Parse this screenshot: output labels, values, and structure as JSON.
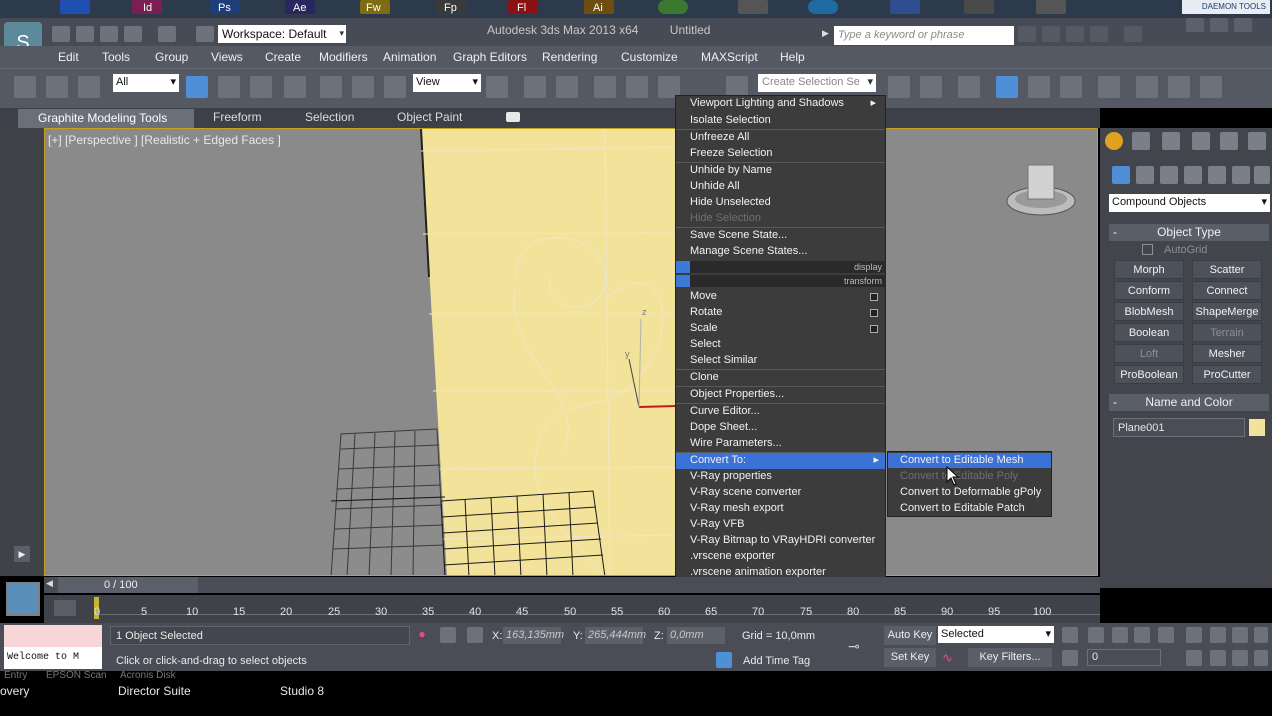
{
  "app": {
    "title": "Autodesk 3ds Max  2013 x64",
    "document": "Untitled",
    "workspace": "Workspace: Default",
    "search_placeholder": "Type a keyword or phrase"
  },
  "taskbar": {
    "badge": "DAEMON TOOLS",
    "labels": [
      "Id",
      "Ps",
      "Ae",
      "Fw",
      "Fp",
      "Fl",
      "Ai"
    ]
  },
  "menubar": [
    "Edit",
    "Tools",
    "Group",
    "Views",
    "Create",
    "Modifiers",
    "Animation",
    "Graph Editors",
    "Rendering",
    "Customize",
    "MAXScript",
    "Help"
  ],
  "toolbar": {
    "selection_filter": "All",
    "ref_coord": "View",
    "named_selection": "Create Selection Se"
  },
  "ribbon": {
    "tabs": [
      "Graphite Modeling Tools",
      "Freeform",
      "Selection",
      "Object Paint"
    ]
  },
  "viewport": {
    "label": "[+] [Perspective ] [Realistic + Edged Faces ]",
    "axis_z": "z",
    "axis_y": "y"
  },
  "quad_menu": {
    "items": [
      {
        "label": "Viewport Lighting and Shadows",
        "submenu": true
      },
      {
        "label": "Isolate Selection"
      },
      {
        "label": "Unfreeze All"
      },
      {
        "label": "Freeze Selection"
      },
      {
        "label": "Unhide by Name"
      },
      {
        "label": "Unhide All"
      },
      {
        "label": "Hide Unselected"
      },
      {
        "label": "Hide Selection",
        "disabled": true
      },
      {
        "label": "Save Scene State..."
      },
      {
        "label": "Manage Scene States..."
      },
      {
        "label": "Move",
        "box": true
      },
      {
        "label": "Rotate",
        "box": true
      },
      {
        "label": "Scale",
        "box": true
      },
      {
        "label": "Select"
      },
      {
        "label": "Select Similar"
      },
      {
        "label": "Clone"
      },
      {
        "label": "Object Properties..."
      },
      {
        "label": "Curve Editor..."
      },
      {
        "label": "Dope Sheet..."
      },
      {
        "label": "Wire Parameters..."
      },
      {
        "label": "Convert To:",
        "submenu": true,
        "highlighted": true
      },
      {
        "label": "V-Ray properties"
      },
      {
        "label": "V-Ray scene converter"
      },
      {
        "label": "V-Ray mesh export"
      },
      {
        "label": "V-Ray VFB"
      },
      {
        "label": "V-Ray Bitmap to VRayHDRI converter"
      },
      {
        "label": ".vrscene exporter"
      },
      {
        "label": ".vrscene animation exporter"
      }
    ],
    "quad_labels": [
      "display",
      "transform"
    ]
  },
  "convert_submenu": [
    {
      "label": "Convert to Editable Mesh",
      "highlighted": true
    },
    {
      "label": "Convert to Editable Poly",
      "disabled": true
    },
    {
      "label": "Convert to Deformable gPoly"
    },
    {
      "label": "Convert to Editable Patch"
    }
  ],
  "command_panel": {
    "category": "Compound Objects",
    "object_type_title": "Object Type",
    "autogrid": "AutoGrid",
    "buttons": [
      {
        "label": "Morph"
      },
      {
        "label": "Scatter"
      },
      {
        "label": "Conform"
      },
      {
        "label": "Connect"
      },
      {
        "label": "BlobMesh"
      },
      {
        "label": "ShapeMerge"
      },
      {
        "label": "Boolean"
      },
      {
        "label": "Terrain",
        "disabled": true
      },
      {
        "label": "Loft",
        "disabled": true
      },
      {
        "label": "Mesher"
      },
      {
        "label": "ProBoolean"
      },
      {
        "label": "ProCutter"
      }
    ],
    "name_color_title": "Name and Color",
    "object_name": "Plane001",
    "object_color": "#f3e39a"
  },
  "timeline": {
    "frame": "0 / 100",
    "ticks": [
      "0",
      "5",
      "10",
      "15",
      "20",
      "25",
      "30",
      "35",
      "40",
      "45",
      "50",
      "55",
      "60",
      "65",
      "70",
      "75",
      "80",
      "85",
      "90",
      "95",
      "100"
    ]
  },
  "status": {
    "maxscript_listener": "Welcome to M",
    "selection": "1 Object Selected",
    "prompt": "Click or click-and-drag to select objects",
    "x_label": "X:",
    "x_value": "163,135mm",
    "y_label": "Y:",
    "y_value": "265,444mm",
    "z_label": "Z:",
    "z_value": "0,0mm",
    "grid": "Grid = 10,0mm",
    "add_time_tag": "Add Time Tag",
    "auto_key": "Auto Key",
    "set_key": "Set Key",
    "key_mode": "Selected",
    "key_filters": "Key Filters...",
    "current_frame": "0"
  },
  "bottom_taskbar": {
    "items": [
      "overy",
      "Director Suite",
      "Studio 8"
    ],
    "faded_items": [
      "Entry",
      "EPSON Scan",
      "Acronis Disk"
    ]
  },
  "colors": {
    "accent": "#3a72d8",
    "viewport_border": "#c7a11a",
    "plane": "#f3e39a"
  }
}
